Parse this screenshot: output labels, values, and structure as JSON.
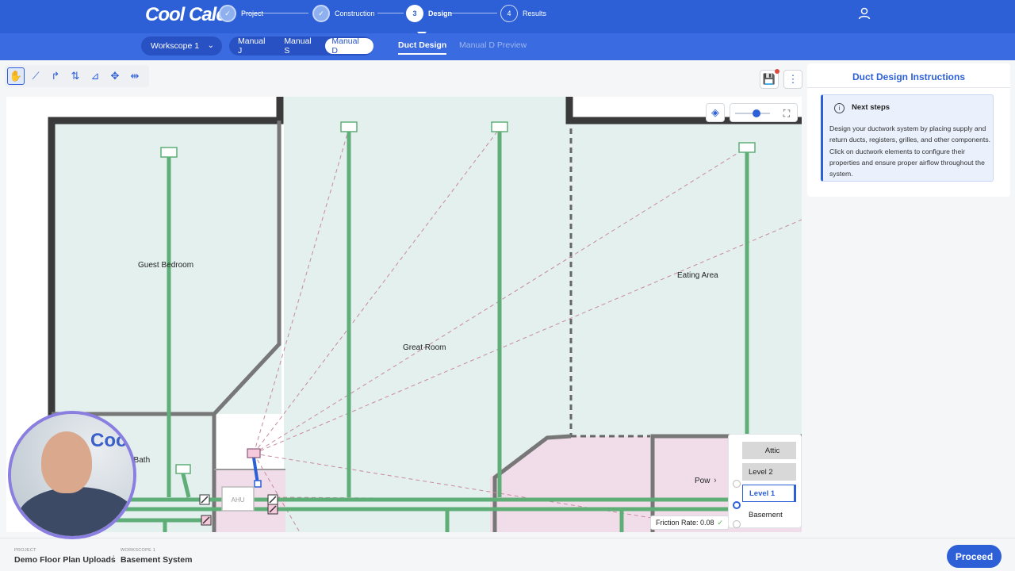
{
  "app": {
    "logo": "Cool Calc"
  },
  "steps": [
    {
      "num": "",
      "label": "Project",
      "state": "done"
    },
    {
      "num": "",
      "label": "Construction",
      "state": "done"
    },
    {
      "num": "3",
      "label": "Design",
      "state": "active"
    },
    {
      "num": "4",
      "label": "Results",
      "state": "todo"
    }
  ],
  "subnav": {
    "workscope": "Workscope 1",
    "manuals": [
      "Manual J",
      "Manual S",
      "Manual D"
    ],
    "active_manual": "Manual D",
    "tabs": [
      "Duct Design",
      "Manual D Preview"
    ]
  },
  "canvas": {
    "rooms": [
      "Guest Bedroom",
      "Great Room",
      "Eating Area",
      "st Bath",
      "Pow"
    ],
    "equipment_label": "AHU",
    "friction_label": "Friction Rate: 0.08",
    "levels": [
      "Attic",
      "Level 2",
      "Level 1",
      "Basement"
    ],
    "active_level": "Level 1",
    "compass": "N"
  },
  "panel": {
    "title": "Duct Design Instructions",
    "card_title": "Next steps",
    "card_body": "Design your ductwork system by placing supply and return ducts, registers, grilles, and other components. Click on ductwork elements to configure their properties and ensure proper airflow throughout the system."
  },
  "footer": {
    "project_caption": "PROJECT",
    "project_name": "Demo Floor Plan Uploads",
    "workscope_caption": "WORKSCOPE 1",
    "workscope_name": "Basement System",
    "proceed": "Proceed"
  },
  "colors": {
    "primary": "#2d5fd6",
    "duct": "#5fae78",
    "room_main": "#e3f0ee",
    "room_lower": "#f1dde9",
    "wall": "#3a3a3a"
  },
  "icons": [
    "hand-icon",
    "duct-draw-icon",
    "flex-duct-icon",
    "riser-icon",
    "slope-icon",
    "move-icon",
    "split-icon",
    "save-icon",
    "more-vertical-icon",
    "layers-icon",
    "fit-screen-icon",
    "user-icon",
    "info-icon",
    "check-icon",
    "chevron-down-icon",
    "chevron-right-icon"
  ]
}
